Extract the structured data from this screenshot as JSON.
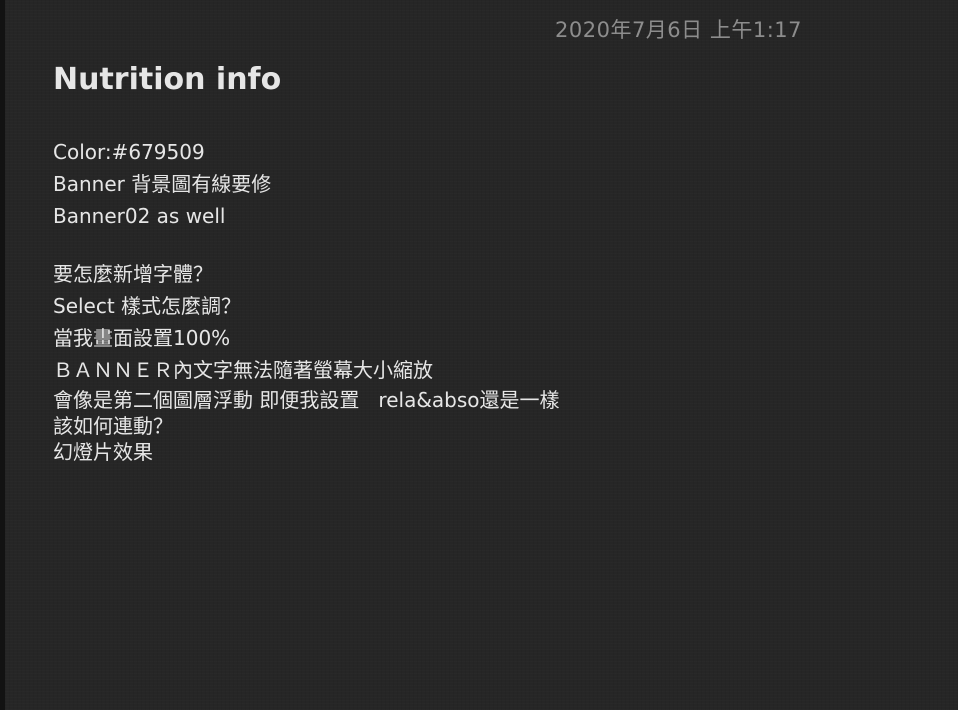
{
  "note": {
    "timestamp": "2020年7月6日 上午1:17",
    "title": "Nutrition info",
    "lines_group1": [
      "Color:#679509",
      "Banner 背景圖有線要修",
      "Banner02 as well"
    ],
    "lines_group2": [
      "要怎麼新增字體？",
      "Select 樣式怎麼調？",
      "當我畫面設置100%",
      "ＢＡＮＮＥＲ內文字無法隨著螢幕大小縮放",
      "會像是第二個圖層浮動 即便我設置   rela&abso還是一樣",
      "該如何連動？",
      "幻燈片效果"
    ]
  },
  "colors": {
    "background": "#262626",
    "text": "#e6e6e6",
    "timestamp": "#8d8d8d"
  }
}
